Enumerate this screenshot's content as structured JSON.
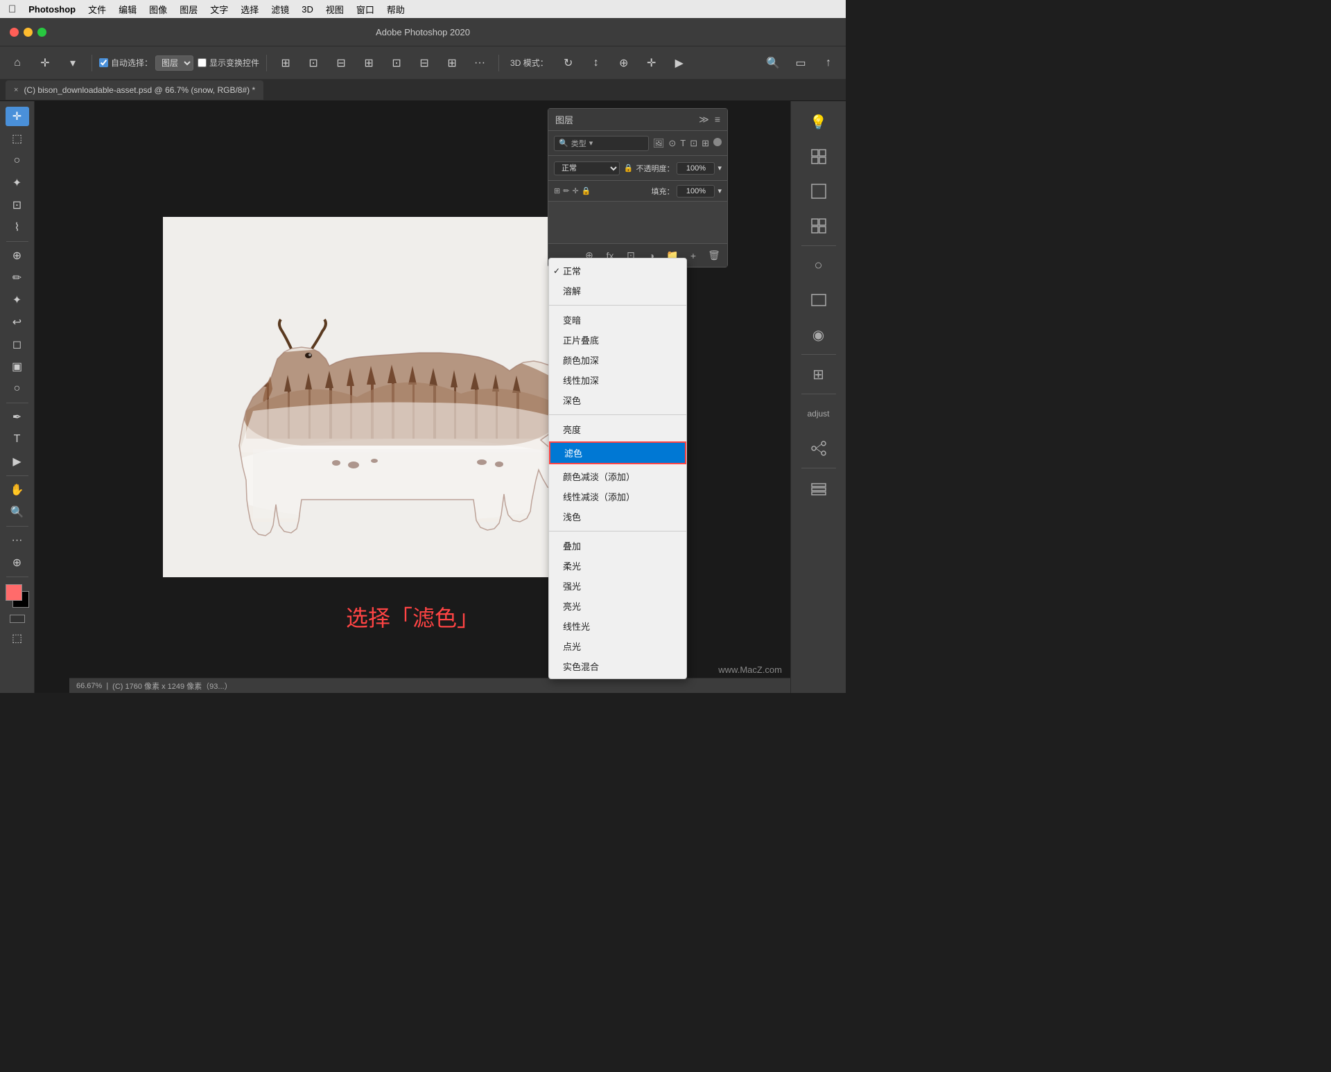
{
  "menubar": {
    "apple": "&#63743;",
    "items": [
      "Photoshop",
      "文件",
      "编辑",
      "图像",
      "图层",
      "文字",
      "选择",
      "滤镜",
      "3D",
      "视图",
      "窗口",
      "帮助"
    ]
  },
  "titlebar": {
    "title": "Adobe Photoshop 2020"
  },
  "toolbar": {
    "auto_select_label": "自动选择：",
    "layer_label": "图层",
    "transform_label": "显示变换控件",
    "mode_label": "3D 模式："
  },
  "tab": {
    "close": "×",
    "filename": "(C) bison_downloadable-asset.psd @ 66.7% (snow, RGB/8#) *"
  },
  "canvas": {
    "caption": "选择「滤色」"
  },
  "statusbar": {
    "zoom": "66.67%",
    "info": "(C) 1760 像素 x 1249 像素（93...）"
  },
  "layers_panel": {
    "title": "图层",
    "filter_placeholder": "类型",
    "opacity_label": "不透明度：",
    "opacity_value": "100%",
    "fill_label": "填充：",
    "fill_value": "100%",
    "blend_mode": "正常"
  },
  "blend_dropdown": {
    "items_group1": [
      "正常",
      "溶解"
    ],
    "items_group2": [
      "变暗",
      "正片叠底",
      "颜色加深",
      "线性加深",
      "深色"
    ],
    "items_group3": [
      "亮度"
    ],
    "selected_item": "滤色",
    "items_group4": [
      "颜色减淡（添加）",
      "线性减淡（添加）",
      "浅色"
    ],
    "items_group5": [
      "叠加",
      "柔光",
      "强光",
      "亮光",
      "线性光",
      "点光",
      "实色混合"
    ]
  },
  "watermark": "www.MacZ.com"
}
